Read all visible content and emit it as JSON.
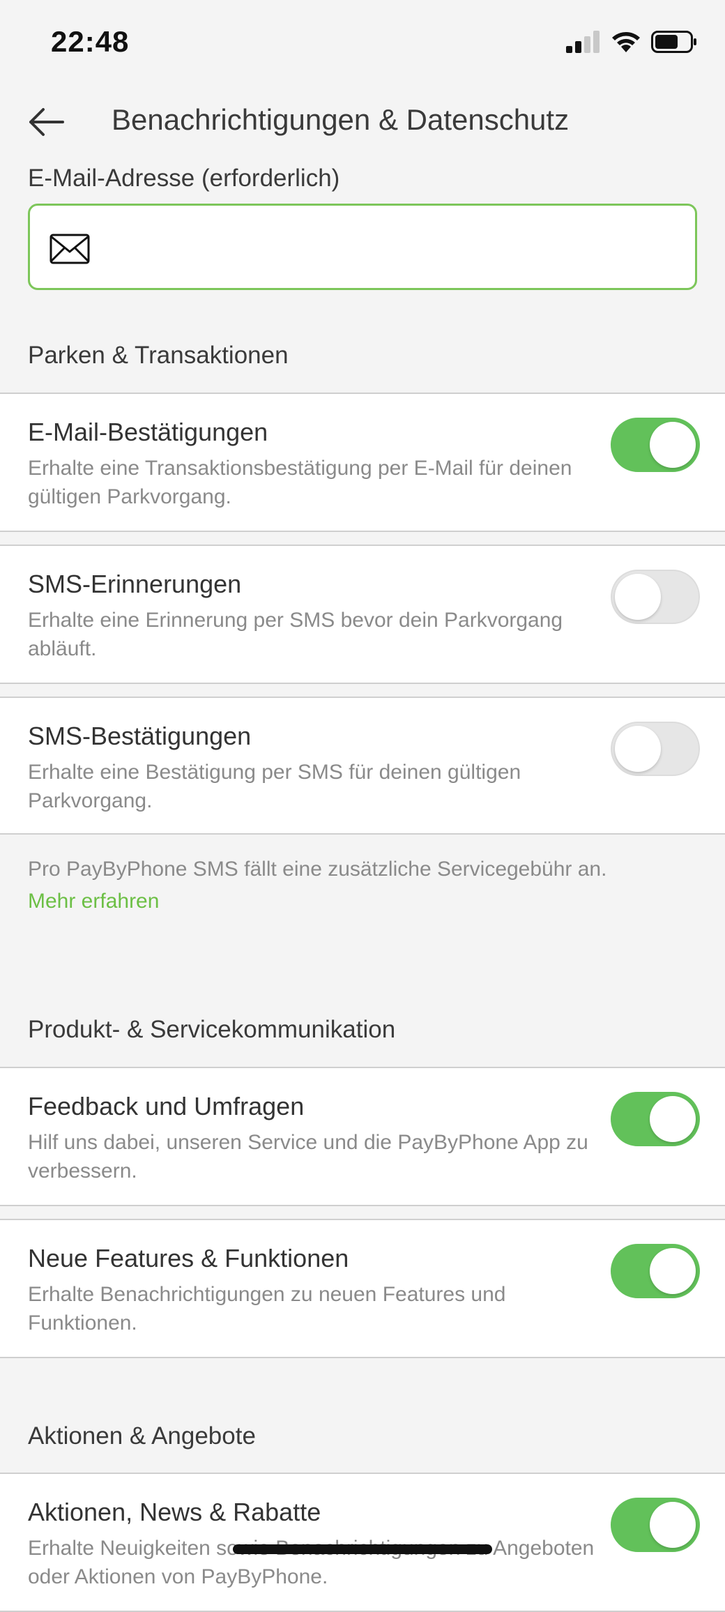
{
  "status_bar": {
    "time": "22:48"
  },
  "header": {
    "title": "Benachrichtigungen & Datenschutz"
  },
  "email": {
    "label": "E-Mail-Adresse (erforderlich)",
    "value": "",
    "placeholder": ""
  },
  "sections": {
    "parking": {
      "title": "Parken & Transaktionen",
      "items": [
        {
          "title": "E-Mail-Bestätigungen",
          "desc": "Erhalte eine Transaktionsbestätigung per E-Mail für deinen gültigen Parkvorgang.",
          "enabled": true
        },
        {
          "title": "SMS-Erinnerungen",
          "desc": "Erhalte eine Erinnerung per SMS bevor dein Parkvorgang abläuft.",
          "enabled": false
        },
        {
          "title": "SMS-Bestätigungen",
          "desc": "Erhalte eine Bestätigung per SMS für deinen gültigen Parkvorgang.",
          "enabled": false
        }
      ],
      "note": "Pro PayByPhone SMS fällt eine zusätzliche Servicegebühr an.",
      "note_link": "Mehr erfahren"
    },
    "product": {
      "title": "Produkt- & Servicekommunikation",
      "items": [
        {
          "title": "Feedback und Umfragen",
          "desc": "Hilf uns dabei, unseren Service und die PayByPhone App zu verbessern.",
          "enabled": true
        },
        {
          "title": "Neue Features & Funktionen",
          "desc": "Erhalte Benachrichtigungen zu neuen Features und Funktionen.",
          "enabled": true
        }
      ]
    },
    "offers": {
      "title": "Aktionen & Angebote",
      "items": [
        {
          "title": "Aktionen, News & Rabatte",
          "desc": "Erhalte Neuigkeiten sowie Benachrichtigungen zu Angeboten oder Aktionen von PayByPhone.",
          "enabled": true
        }
      ]
    }
  },
  "colors": {
    "accent": "#62c15a",
    "link": "#6cbf45",
    "field_border": "#7dc65a"
  }
}
